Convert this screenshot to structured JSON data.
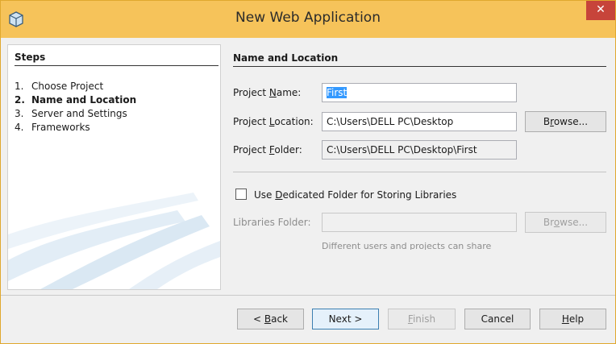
{
  "window": {
    "title": "New Web Application",
    "close_glyph": "✕"
  },
  "steps": {
    "heading": "Steps",
    "items": [
      {
        "num": "1.",
        "label": "Choose Project"
      },
      {
        "num": "2.",
        "label": "Name and Location"
      },
      {
        "num": "3.",
        "label": "Server and Settings"
      },
      {
        "num": "4.",
        "label": "Frameworks"
      }
    ],
    "current_index": 1
  },
  "main": {
    "heading": "Name and Location",
    "project_name": {
      "label_pre": "Project ",
      "label_mnemonic": "N",
      "label_post": "ame:",
      "value": "First"
    },
    "project_location": {
      "label_pre": "Project ",
      "label_mnemonic": "L",
      "label_post": "ocation:",
      "value": "C:\\Users\\DELL PC\\Desktop"
    },
    "project_folder": {
      "label_pre": "Project ",
      "label_mnemonic": "F",
      "label_post": "older:",
      "value": "C:\\Users\\DELL PC\\Desktop\\First"
    },
    "browse_location": {
      "pre": "B",
      "mnemonic": "r",
      "post": "owse..."
    },
    "dedicated_folder": {
      "pre": "Use ",
      "mnemonic": "D",
      "post": "edicated Folder for Storing Libraries",
      "checked": false
    },
    "libraries_folder": {
      "label": "Libraries Folder:",
      "value": ""
    },
    "browse_libraries": {
      "pre": "Br",
      "mnemonic": "o",
      "post": "wse..."
    },
    "clipped_note": "Different users and projects can share"
  },
  "footer": {
    "back": {
      "pre": "< ",
      "mnemonic": "B",
      "post": "ack"
    },
    "next": {
      "label": "Next >"
    },
    "finish": {
      "mnemonic": "F",
      "post": "inish"
    },
    "cancel": {
      "label": "Cancel"
    },
    "help": {
      "mnemonic": "H",
      "post": "elp"
    }
  },
  "colors": {
    "titlebar": "#f6c35a",
    "close": "#c7443a",
    "selection": "#3399ff"
  },
  "icons": {
    "app": "netbeans-cube-icon",
    "close": "close-icon"
  }
}
